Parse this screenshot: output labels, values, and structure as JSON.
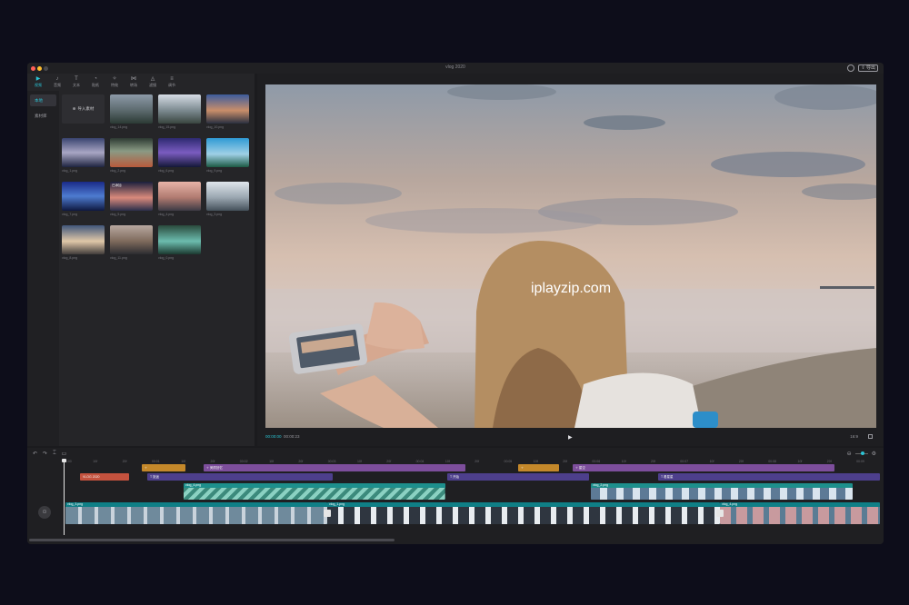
{
  "window": {
    "title": "vlog 2020",
    "export_label": "导出"
  },
  "tabs": [
    {
      "label": "视频",
      "icon": "▶"
    },
    {
      "label": "音频",
      "icon": "♪"
    },
    {
      "label": "文本",
      "icon": "T"
    },
    {
      "label": "贴纸",
      "icon": "◔"
    },
    {
      "label": "特效",
      "icon": "✧"
    },
    {
      "label": "转场",
      "icon": "⋈"
    },
    {
      "label": "滤镜",
      "icon": "◬"
    },
    {
      "label": "调节",
      "icon": "≡"
    }
  ],
  "sidenav": [
    {
      "label": "本地"
    },
    {
      "label": "素材库"
    }
  ],
  "media": {
    "import_label": "导入素材",
    "items": [
      {
        "name": "vlog_14.png",
        "badge": ""
      },
      {
        "name": "vlog_15.png",
        "badge": ""
      },
      {
        "name": "vlog_10.png",
        "badge": ""
      },
      {
        "name": "vlog_1.png",
        "badge": ""
      },
      {
        "name": "vlog_2.png",
        "badge": ""
      },
      {
        "name": "vlog_6.png",
        "badge": ""
      },
      {
        "name": "vlog_9.png",
        "badge": ""
      },
      {
        "name": "vlog_7.png",
        "badge": ""
      },
      {
        "name": "vlog_5.png",
        "badge": "已添加"
      },
      {
        "name": "vlog_4.png",
        "badge": ""
      },
      {
        "name": "vlog_3.png",
        "badge": ""
      },
      {
        "name": "vlog_8.png",
        "badge": ""
      },
      {
        "name": "vlog_11.png",
        "badge": ""
      },
      {
        "name": "vlog_0.png",
        "badge": ""
      }
    ]
  },
  "preview": {
    "watermark": "iplayzip.com",
    "current_time": "00:00:00",
    "duration": "00:00:23",
    "ratio_label": "16:9"
  },
  "timeline": {
    "ruler": [
      "00:00",
      "10f",
      "20f",
      "00:01",
      "10f",
      "20f",
      "00:02",
      "10f",
      "20f",
      "00:03",
      "10f",
      "20f",
      "00:04",
      "10f",
      "20f",
      "00:05",
      "10f",
      "20f",
      "00:06",
      "10f",
      "20f",
      "00:07",
      "10f",
      "20f",
      "00:08",
      "10f",
      "20f",
      "00:09"
    ],
    "tracks": {
      "effects": [
        {
          "label": "✧",
          "color": "#c4882a"
        },
        {
          "label": "✧ 美丽回忆",
          "color": "#7d4e9c"
        },
        {
          "label": "✧",
          "color": "#c4882a"
        },
        {
          "label": "✧ 星空",
          "color": "#7d4e9c"
        }
      ],
      "text_red": "VLOG 2020",
      "texts": [
        {
          "label": "T 旅途"
        },
        {
          "label": "T 开始"
        },
        {
          "label": "T 看星星"
        }
      ],
      "overlays": [
        {
          "name": "vlog_4.png"
        },
        {
          "name": "vlog_2.png"
        }
      ],
      "main": [
        {
          "name": "vlog_3.png",
          "frame_label": "4.4s"
        },
        {
          "name": "vlog_1.png",
          "frame_label": "4.4s"
        },
        {
          "name": "vlog_4.png",
          "frame_label": "4.4s"
        }
      ]
    }
  }
}
